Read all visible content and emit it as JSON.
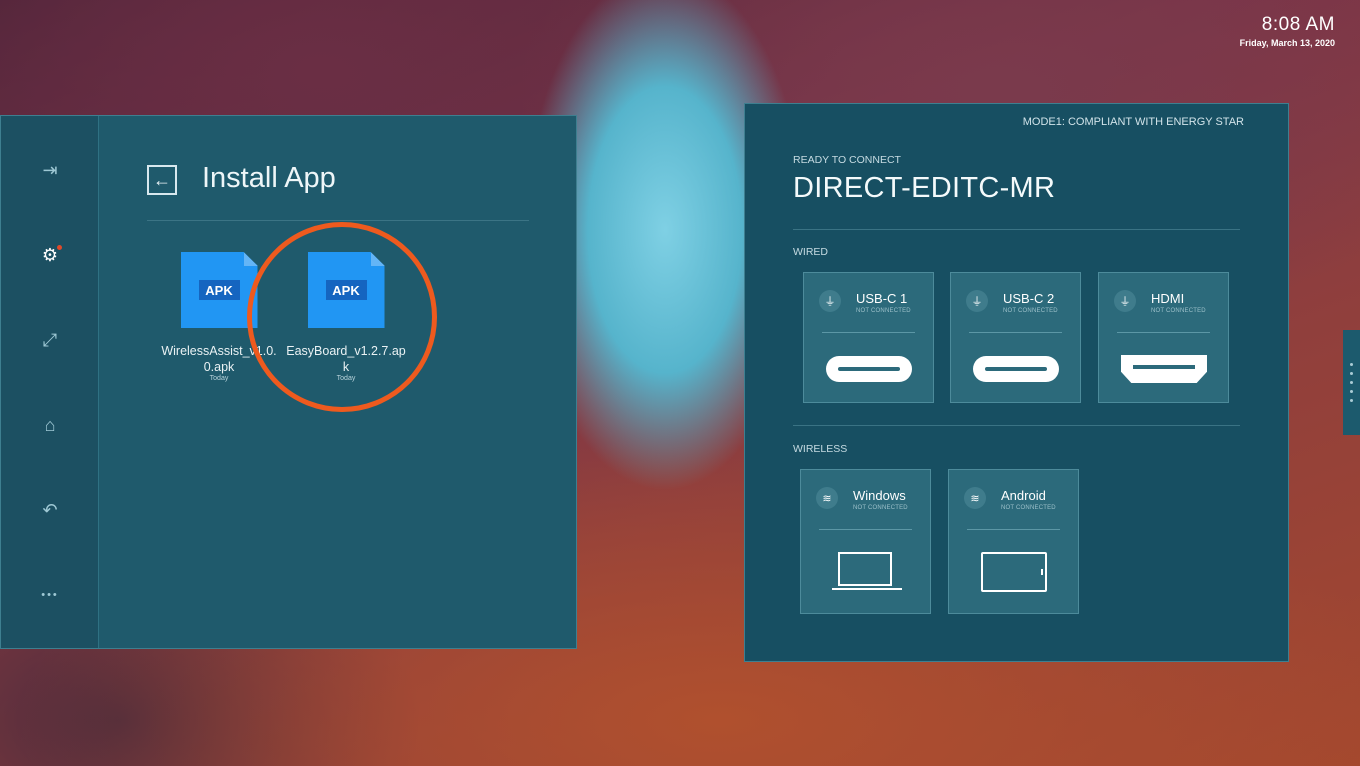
{
  "clock": {
    "time": "8:08 AM",
    "date": "Friday, March 13, 2020"
  },
  "rail": {
    "items": [
      {
        "name": "input-source",
        "icon": "sign-in-icon",
        "glyph": "⇥"
      },
      {
        "name": "settings",
        "icon": "gear-icon",
        "glyph": "⚙",
        "active": true,
        "badge": true
      },
      {
        "name": "screen-capture",
        "icon": "expand-icon",
        "glyph": "⤢"
      },
      {
        "name": "home",
        "icon": "home-icon",
        "glyph": "⌂"
      },
      {
        "name": "back",
        "icon": "undo-icon",
        "glyph": "↶"
      },
      {
        "name": "more",
        "icon": "more-dots-icon",
        "glyph": "•••"
      }
    ]
  },
  "install": {
    "title": "Install App",
    "files": [
      {
        "tag": "APK",
        "name": "WirelessAssist_v1.0.0.apk",
        "date": "Today"
      },
      {
        "tag": "APK",
        "name": "EasyBoard_v1.2.7.apk",
        "date": "Today"
      }
    ],
    "highlight_color": "#ee5a1e"
  },
  "connect": {
    "mode": "MODE1: COMPLIANT WITH ENERGY STAR",
    "ready_label": "READY TO CONNECT",
    "device_name": "DIRECT-EDITC-MR",
    "wired_label": "WIRED",
    "wireless_label": "WIRELESS",
    "wired": [
      {
        "name": "USB-C 1",
        "status": "NOT CONNECTED",
        "icon": "usb-plug-icon"
      },
      {
        "name": "USB-C 2",
        "status": "NOT CONNECTED",
        "icon": "usb-plug-icon"
      },
      {
        "name": "HDMI",
        "status": "NOT CONNECTED",
        "icon": "hdmi-plug-icon"
      }
    ],
    "wireless": [
      {
        "name": "Windows",
        "status": "NOT CONNECTED",
        "icon": "wifi-icon"
      },
      {
        "name": "Android",
        "status": "NOT CONNECTED",
        "icon": "wifi-icon"
      }
    ]
  },
  "colors": {
    "panel": "#1f5a6c",
    "accent": "#2196f3",
    "highlight": "#ee5a1e"
  }
}
